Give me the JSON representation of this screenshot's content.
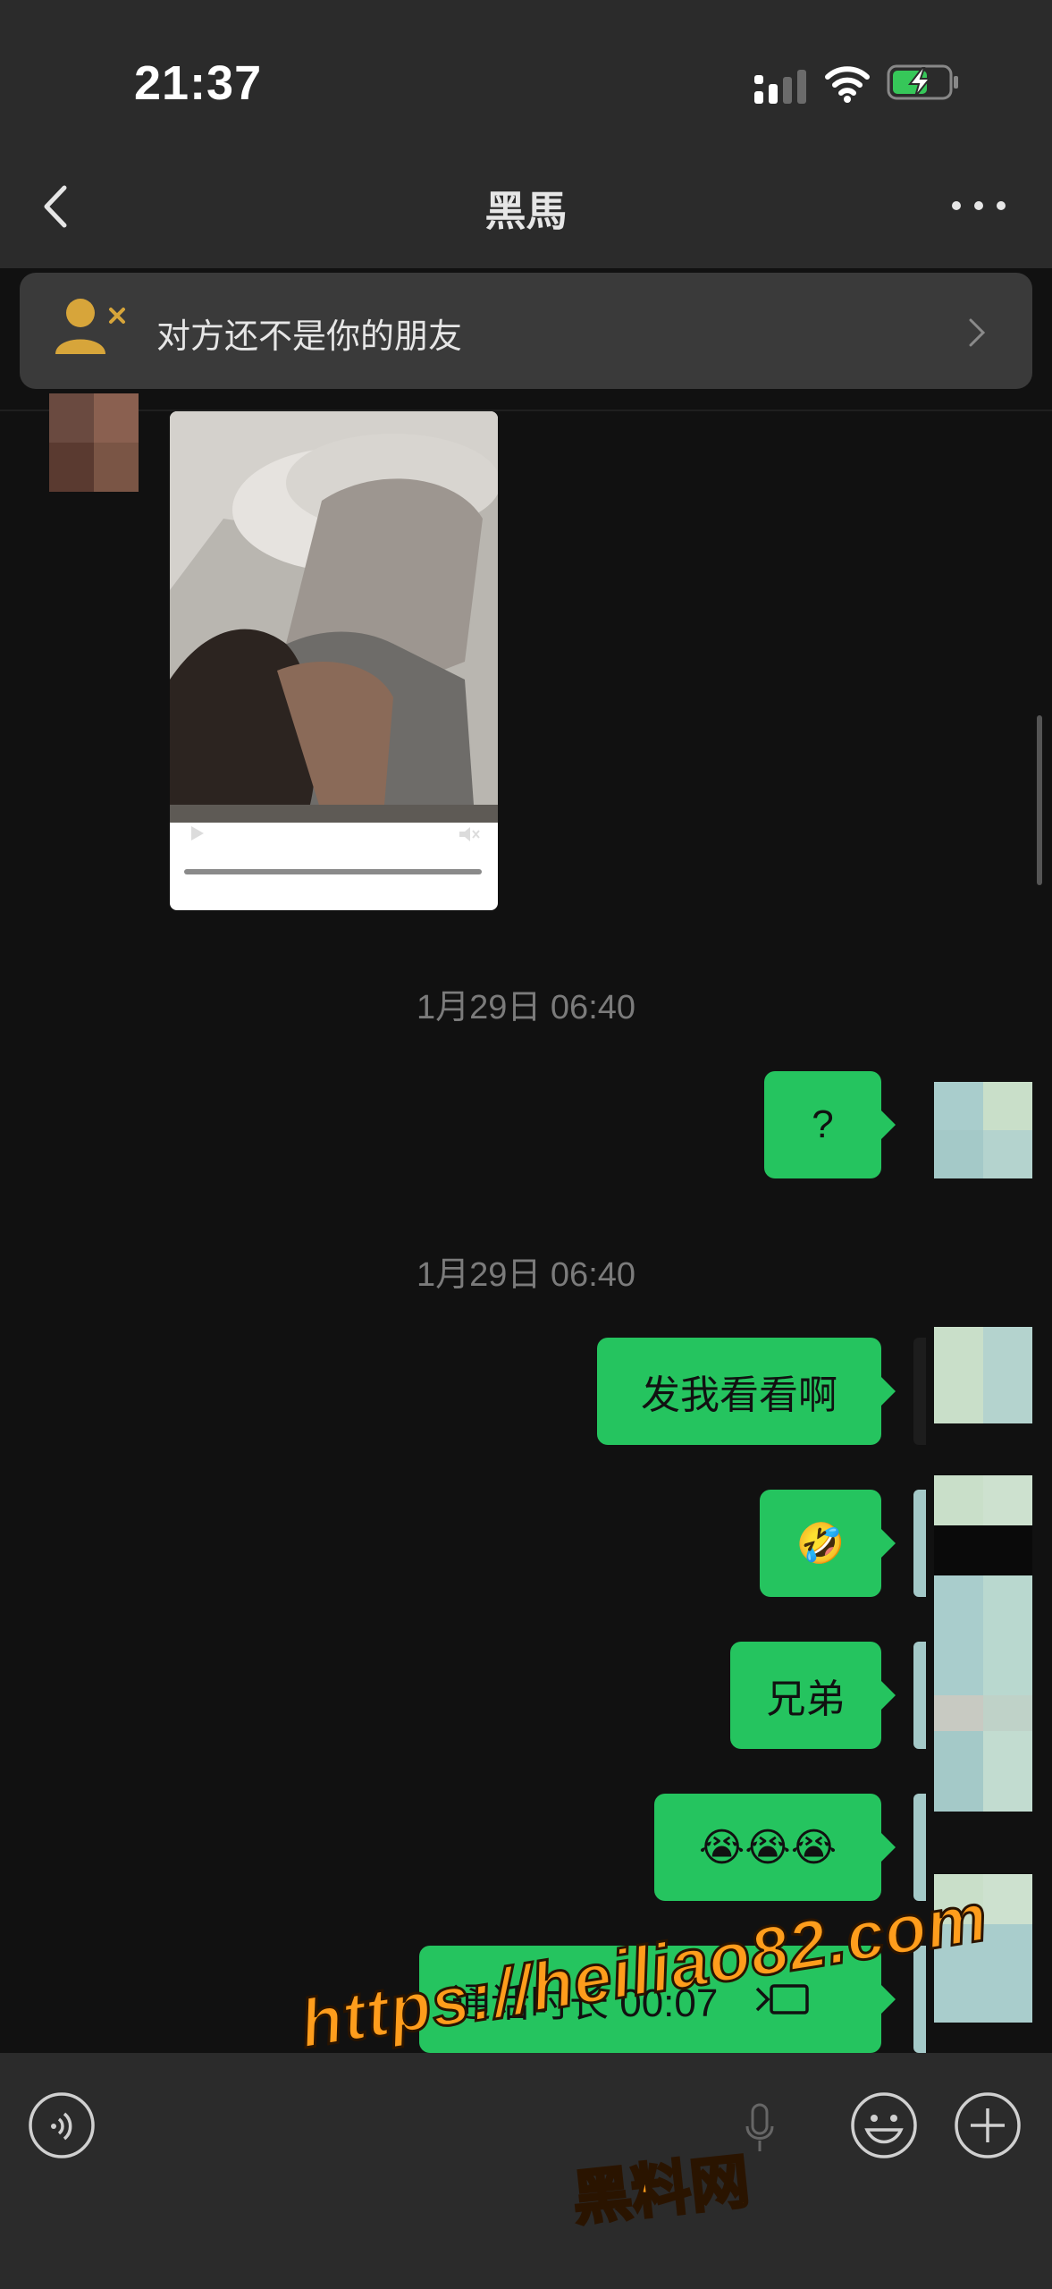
{
  "status_bar": {
    "time": "21:37"
  },
  "nav": {
    "title": "黑馬"
  },
  "banner": {
    "text": "对方还不是你的朋友"
  },
  "messages": [
    {
      "type": "video",
      "side": "left"
    },
    {
      "type": "timestamp",
      "text": "1月29日 06:40"
    },
    {
      "type": "text",
      "side": "right",
      "text": "?"
    },
    {
      "type": "timestamp",
      "text": "1月29日 06:40"
    },
    {
      "type": "text",
      "side": "right",
      "text": "发我看看啊"
    },
    {
      "type": "text",
      "side": "right",
      "text": "🤣"
    },
    {
      "type": "text",
      "side": "right",
      "text": "兄弟"
    },
    {
      "type": "text",
      "side": "right",
      "text": "😭😭😭"
    },
    {
      "type": "call",
      "side": "right",
      "text": "通话时长 00:07"
    }
  ],
  "watermark": {
    "url": "https://heiliao82.com",
    "name": "黑料网"
  },
  "colors": {
    "bubble": "#25c45f",
    "background": "#111111",
    "bar": "#2b2b2b",
    "banner_icon": "#d7a53a",
    "watermark": "#ff9d1c"
  }
}
